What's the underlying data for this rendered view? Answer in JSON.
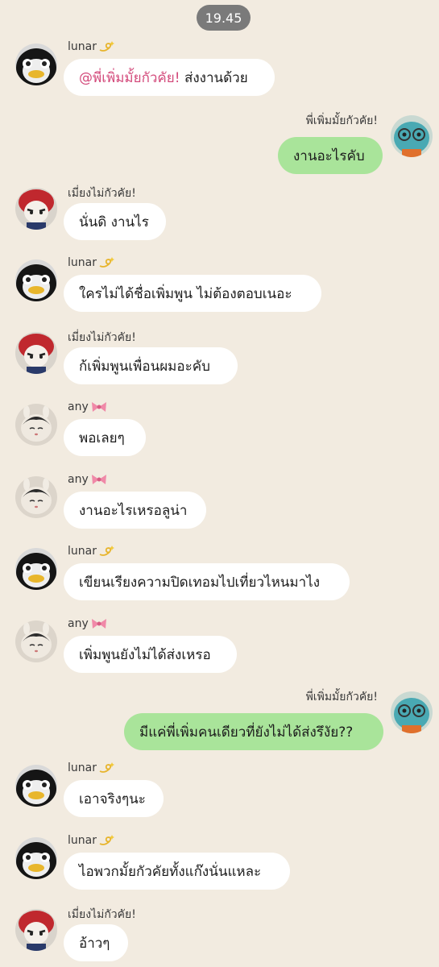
{
  "timestamp": "19.45",
  "messages": [
    {
      "side": "in",
      "sender": "lunar",
      "sender_icon": "dizzy-emoji-icon",
      "avatar": "penguin-avatar",
      "mention": "@พี่เพิ่มมั้ยกัวคัย!",
      "text": " ส่งงานด้วย"
    },
    {
      "side": "out",
      "sender": "พี่เพิ่มมั้ยกัวคัย!",
      "avatar": "blue-plush-avatar",
      "text": "งานอะไรคับ"
    },
    {
      "side": "in",
      "sender": "เมี่ยงไม่กัวคัย!",
      "avatar": "red-hair-avatar",
      "text": "นั่นดิ งานไร"
    },
    {
      "side": "in",
      "sender": "lunar",
      "sender_icon": "dizzy-emoji-icon",
      "avatar": "penguin-avatar",
      "text": "ใครไม่ได้ชื่อเพิ่มพูน ไม่ต้องตอบเนอะ"
    },
    {
      "side": "in",
      "sender": "เมี่ยงไม่กัวคัย!",
      "avatar": "red-hair-avatar",
      "text": "ก้เพิ่มพูนเพื่อนผมอะคับ"
    },
    {
      "side": "in",
      "sender": "any",
      "sender_icon": "ribbon-emoji-icon",
      "avatar": "plush-doll-avatar",
      "text": "พอเลยๆ"
    },
    {
      "side": "in",
      "sender": "any",
      "sender_icon": "ribbon-emoji-icon",
      "avatar": "plush-doll-avatar",
      "text": "งานอะไรเหรอลูน่า"
    },
    {
      "side": "in",
      "sender": "lunar",
      "sender_icon": "dizzy-emoji-icon",
      "avatar": "penguin-avatar",
      "text": "เขียนเรียงความปิดเทอมไปเที่ยวไหนมาไง"
    },
    {
      "side": "in",
      "sender": "any",
      "sender_icon": "ribbon-emoji-icon",
      "avatar": "plush-doll-avatar",
      "text": "เพิ่มพูนยังไม่ได้ส่งเหรอ"
    },
    {
      "side": "out",
      "sender": "พี่เพิ่มมั้ยกัวคัย!",
      "avatar": "blue-plush-avatar",
      "text": "มีแค่พี่เพิ่มคนเดียวที่ยังไม่ได้ส่งรึงัย??"
    },
    {
      "side": "in",
      "sender": "lunar",
      "sender_icon": "dizzy-emoji-icon",
      "avatar": "penguin-avatar",
      "text": "เอาจริงๆนะ"
    },
    {
      "side": "in",
      "sender": "lunar",
      "sender_icon": "dizzy-emoji-icon",
      "avatar": "penguin-avatar",
      "text": "ไอพวกมั้ยกัวคัยทั้งแก๊งนั่นแหละ"
    },
    {
      "side": "in",
      "sender": "เมี่ยงไม่กัวคัย!",
      "avatar": "red-hair-avatar",
      "text": "อ้าวๆ"
    }
  ],
  "colors": {
    "background": "#f2ebe0",
    "incoming_bubble": "#ffffff",
    "outgoing_bubble": "#a9e49a",
    "mention": "#d34a7b",
    "time_pill": "#7a7a7a"
  }
}
